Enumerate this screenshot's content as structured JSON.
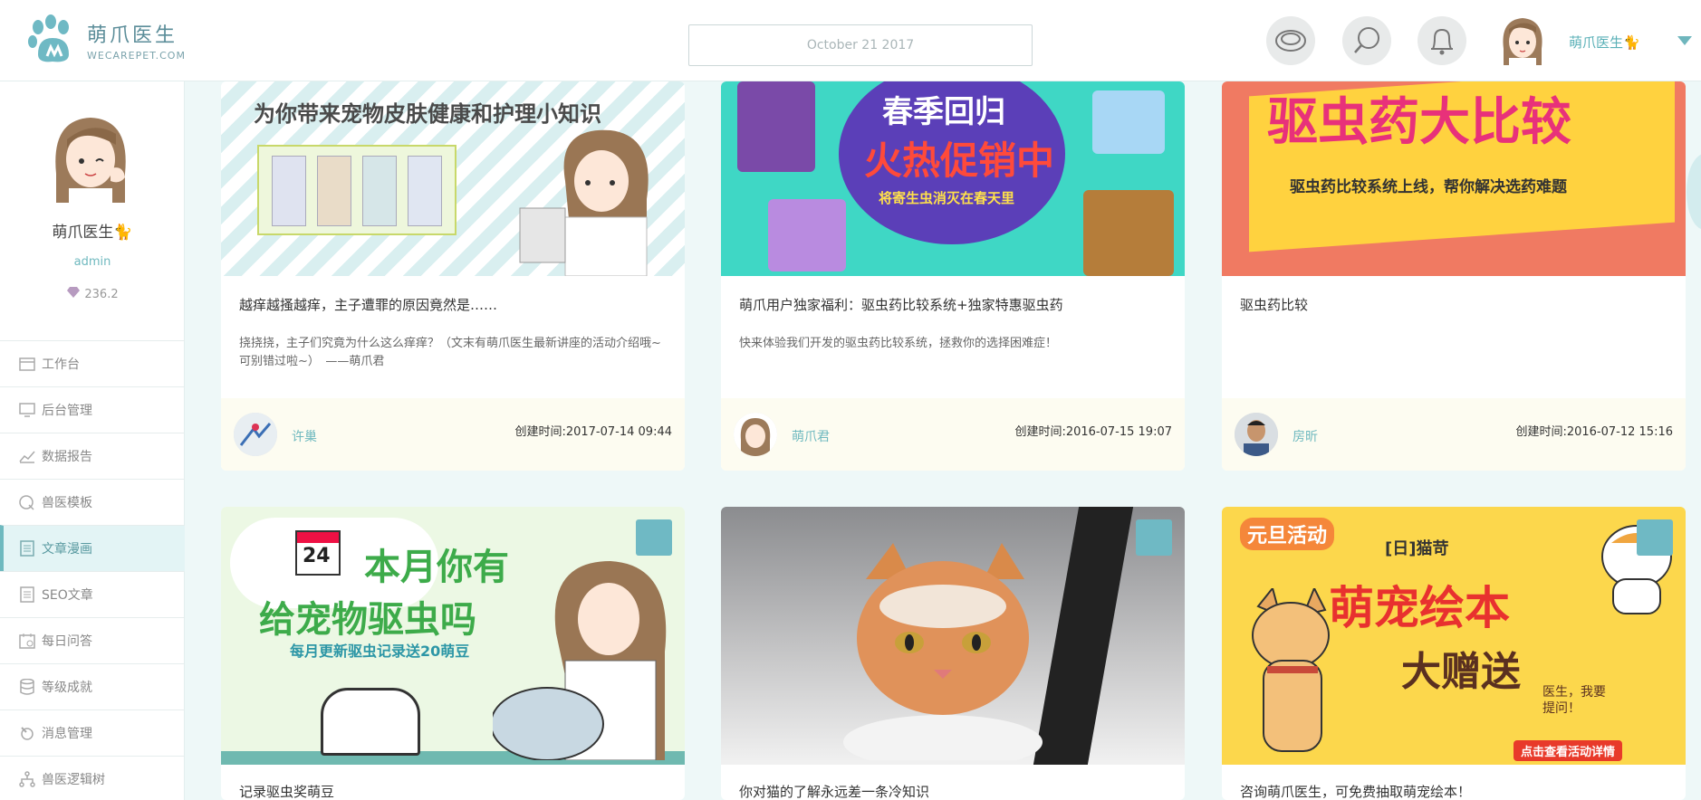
{
  "app": {
    "logo_cn": "萌爪医生",
    "logo_en": "WECAREPET.COM",
    "date": "October 21 2017",
    "user_name": "萌爪医生🐈"
  },
  "sidebar": {
    "name": "萌爪医生🐈",
    "role": "admin",
    "points": "236.2",
    "items": [
      {
        "label": "工作台",
        "icon": "calendar-icon"
      },
      {
        "label": "后台管理",
        "icon": "monitor-icon"
      },
      {
        "label": "数据报告",
        "icon": "chart-icon"
      },
      {
        "label": "兽医模板",
        "icon": "shield-icon"
      },
      {
        "label": "文章漫画",
        "icon": "document-icon"
      },
      {
        "label": "SEO文章",
        "icon": "seo-document-icon"
      },
      {
        "label": "每日问答",
        "icon": "date-icon"
      },
      {
        "label": "等级成就",
        "icon": "database-icon"
      },
      {
        "label": "消息管理",
        "icon": "message-icon"
      },
      {
        "label": "兽医逻辑树",
        "icon": "tree-icon"
      }
    ],
    "active_index": 4
  },
  "cards": [
    {
      "banner_line": "为你带来宠物皮肤健康和护理小知识",
      "title": "越痒越搔越痒，主子遭罪的原因竟然是……",
      "desc": "挠挠挠，主子们究竟为什么这么痒痒？（文末有萌爪医生最新讲座的活动介绍哦~可别错过啦~）　——萌爪君",
      "author": "许巢",
      "time": "创建时间:2017-07-14 09:44"
    },
    {
      "banner_line1": "春季回归",
      "banner_line2": "火热促销中",
      "banner_line3": "将寄生虫消灭在春天里",
      "title": "萌爪用户独家福利：驱虫药比较系统+独家特惠驱虫药",
      "desc": "快来体验我们开发的驱虫药比较系统，拯救你的选择困难症！",
      "author": "萌爪君",
      "time": "创建时间:2016-07-15 19:07"
    },
    {
      "banner_line1": "驱虫药大比较",
      "banner_line2": "驱虫药比较系统上线，帮你解决选药难题",
      "title": "驱虫药比较",
      "desc": "",
      "author": "房昕",
      "time": "创建时间:2016-07-12 15:16"
    },
    {
      "banner_date": "24",
      "banner_line1": "本月你有",
      "banner_line2": "给宠物驱虫吗",
      "banner_line3": "每月更新驱虫记录送20萌豆",
      "title": "记录驱虫奖萌豆"
    },
    {
      "title": "你对猫的了解永远差一条冷知识"
    },
    {
      "banner_tag": "元旦活动",
      "banner_sub": "[日]猫苛",
      "banner_line1": "萌宠绘本",
      "banner_line2": "大赠送",
      "banner_bubble": "医生，我要提问！",
      "banner_btn": "点击查看活动详情",
      "title": "咨询萌爪医生，可免费抽取萌宠绘本！"
    }
  ],
  "colors": {
    "accent": "#6fb9bf",
    "bg": "#eef8f8"
  }
}
